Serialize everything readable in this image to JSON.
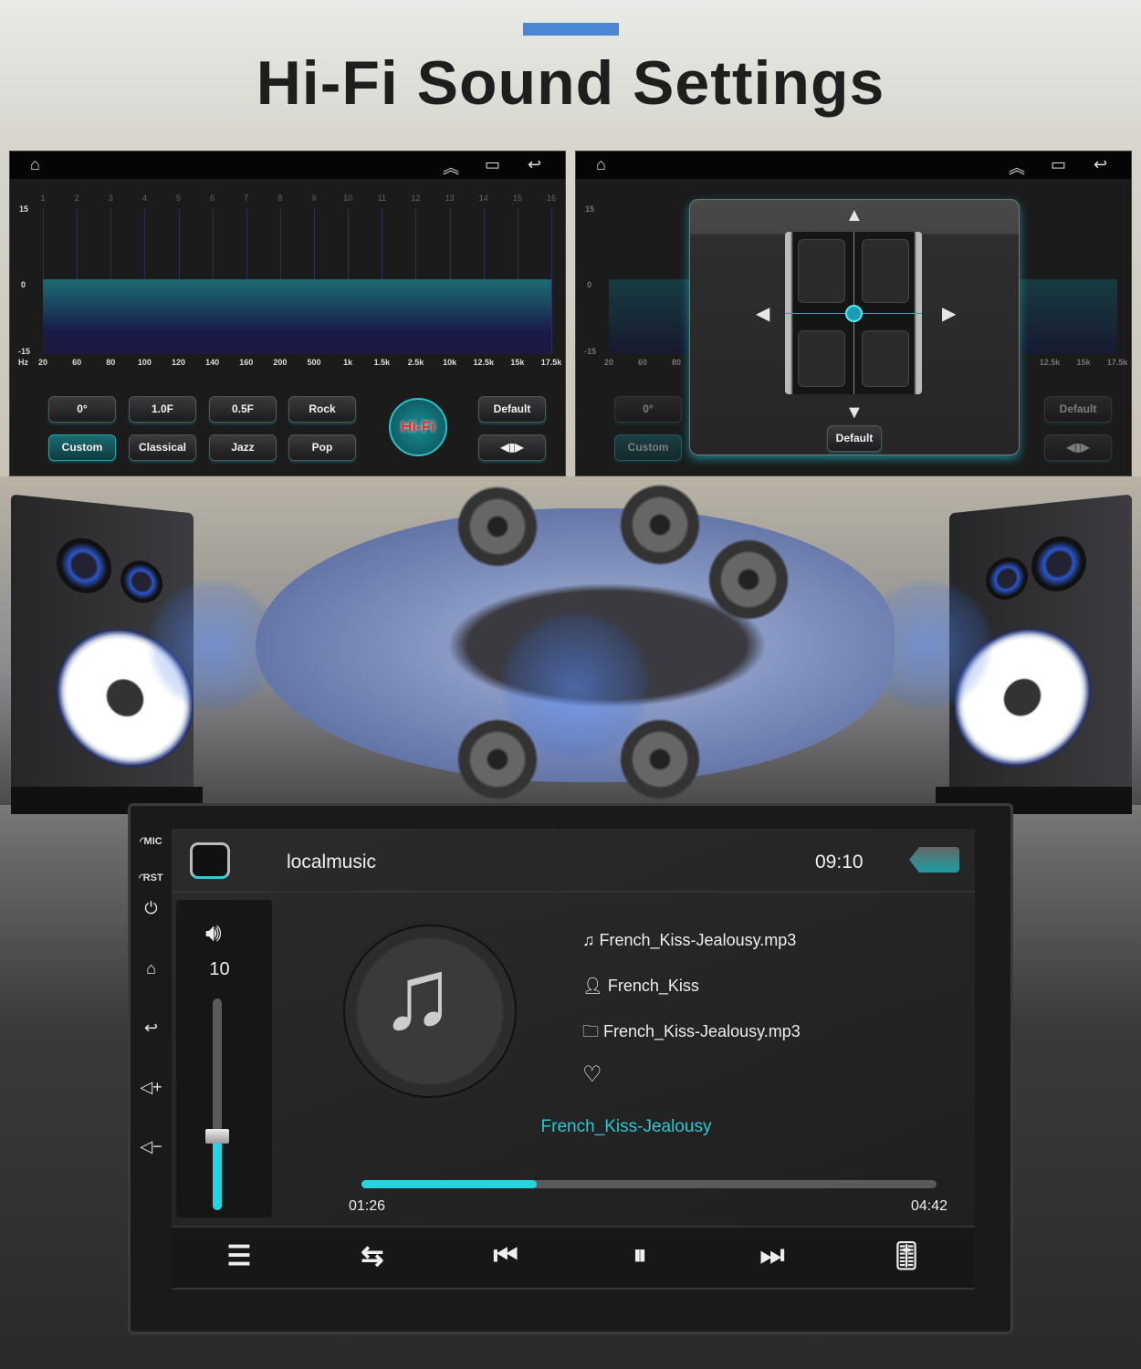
{
  "header": {
    "title": "Hi-Fi Sound Settings",
    "accent_color": "#4a86d4"
  },
  "equalizer": {
    "band_numbers": [
      "1",
      "2",
      "3",
      "4",
      "5",
      "6",
      "7",
      "8",
      "9",
      "10",
      "11",
      "12",
      "13",
      "14",
      "15",
      "16"
    ],
    "frequencies": [
      "20",
      "60",
      "80",
      "100",
      "120",
      "140",
      "160",
      "200",
      "500",
      "1k",
      "1.5k",
      "2.5k",
      "10k",
      "12.5k",
      "15k",
      "17.5k"
    ],
    "unit": "Hz",
    "y_max": "15",
    "y_mid": "0",
    "y_min": "-15",
    "band_gains": [
      0,
      0,
      0,
      0,
      0,
      0,
      0,
      0,
      0,
      0,
      0,
      0,
      0,
      0,
      0,
      0
    ],
    "buttons_row1": [
      "0°",
      "1.0F",
      "0.5F",
      "Rock"
    ],
    "buttons_row2": [
      "Custom",
      "Classical",
      "Jazz",
      "Pop"
    ],
    "active_preset": "Custom",
    "hifi_label": "Hi-Fi",
    "default_label": "Default",
    "status_icons": [
      "home-icon",
      "double-chevron-up-icon",
      "recent-apps-icon",
      "back-icon"
    ]
  },
  "balance": {
    "default_label": "Default",
    "dim_custom": "Custom",
    "dim_zero": "0°",
    "dim_default": "Default",
    "freq_left": [
      "20",
      "60",
      "80"
    ],
    "freq_right": [
      "12.5k",
      "15k",
      "17.5k"
    ]
  },
  "player": {
    "side_labels": {
      "mic": "MIC",
      "rst": "RST"
    },
    "app_title": "localmusic",
    "clock": "09:10",
    "volume": "10",
    "volume_level": 0.35,
    "file_name": "French_Kiss-Jealousy.mp3",
    "artist": "French_Kiss",
    "folder": "French_Kiss-Jealousy.mp3",
    "song_title": "French_Kiss-Jealousy",
    "elapsed": "01:26",
    "duration": "04:42",
    "progress": 0.305,
    "accent_color": "#22d6e0"
  }
}
